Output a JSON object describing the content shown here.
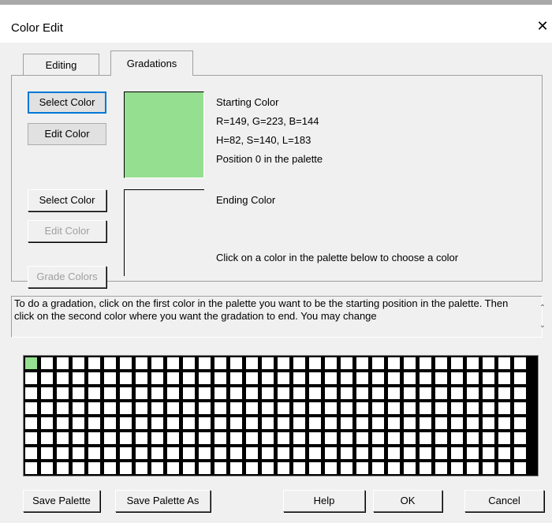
{
  "window": {
    "title": "Color Edit",
    "close_icon": "close-icon"
  },
  "tabs": [
    {
      "label": "Editing",
      "active": false
    },
    {
      "label": "Gradations",
      "active": true
    }
  ],
  "starting": {
    "select_label": "Select Color",
    "edit_label": "Edit Color",
    "swatch_color": "#95df90",
    "lines": [
      "Starting Color",
      "R=149, G=223, B=144",
      "H=82, S=140, L=183",
      "Position 0 in the palette"
    ]
  },
  "ending": {
    "select_label": "Select Color",
    "edit_label": "Edit Color",
    "grade_label": "Grade Colors",
    "title": "Ending Color",
    "hint": "Click on a color in the palette below to choose a color"
  },
  "description": "To do a gradation, click on the first color in the palette you want to be the starting position in the palette. Then click on the second color where you want the gradation to end. You may change",
  "palette": {
    "cols": 32,
    "rows": 8,
    "selected_index": 0,
    "selected_color": "#95df90"
  },
  "footer": {
    "save_palette": "Save Palette",
    "save_palette_as": "Save Palette As",
    "help": "Help",
    "ok": "OK",
    "cancel": "Cancel"
  }
}
